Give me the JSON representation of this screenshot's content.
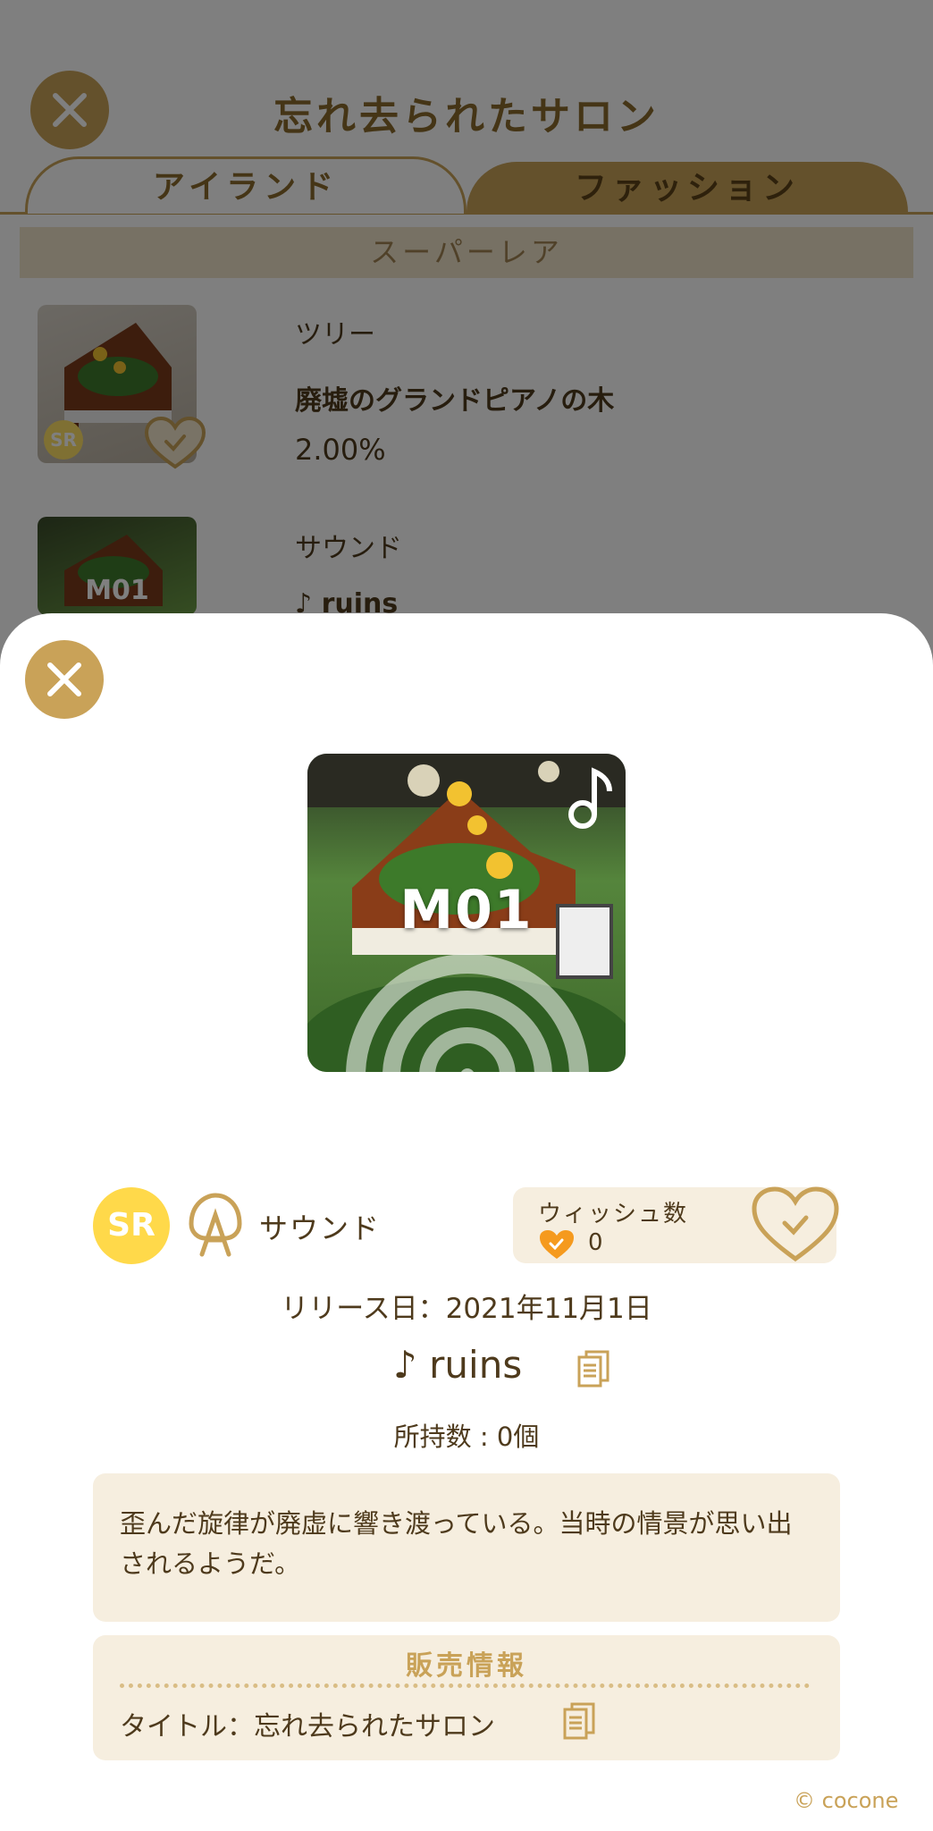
{
  "background": {
    "title": "忘れ去られたサロン",
    "tabs": [
      {
        "label": "アイランド"
      },
      {
        "label": "ファッション"
      }
    ],
    "rarity_header": "スーパーレア",
    "items": [
      {
        "category": "ツリー",
        "name": "廃墟のグランドピアノの木",
        "rate": "2.00%",
        "badge": "SR"
      },
      {
        "category": "サウンド",
        "name": "♪ ruins"
      }
    ]
  },
  "detail": {
    "art_code": "M01",
    "rarity_badge": "SR",
    "category": "サウンド",
    "wish": {
      "label": "ウィッシュ数",
      "count": "0"
    },
    "release": "リリース日：2021年11月1日",
    "title": "♪ ruins",
    "owned": "所持数 : 0個",
    "description": "歪んだ旋律が廃虚に響き渡っている。当時の情景が思い出されるようだ。",
    "sale": {
      "header": "販売情報",
      "title_line": "タイトル：忘れ去られたサロン"
    }
  },
  "copyright": "© cocone",
  "colors": {
    "accent": "#c9a258",
    "text": "#4e3a1c",
    "panel": "#f6eedf",
    "sr_yellow": "#ffd94a",
    "heart_orange": "#f59a1e"
  },
  "icons": [
    "close-icon",
    "heart-check-icon",
    "music-note-icon",
    "disc-icon",
    "sound-category-icon",
    "copy-document-icon"
  ]
}
